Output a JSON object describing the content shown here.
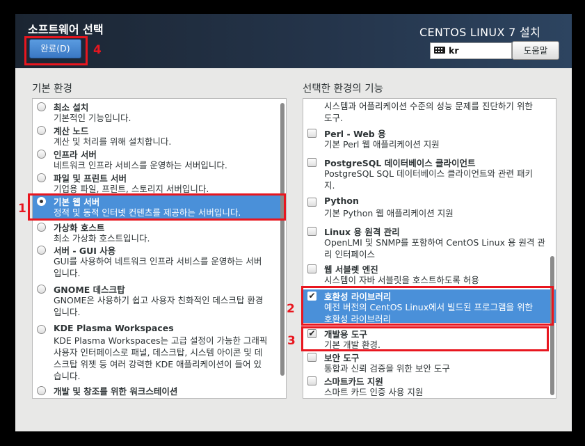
{
  "header": {
    "title": "소프트웨어 선택",
    "done_label": "완료(D)",
    "product": "CENTOS LINUX 7 설치",
    "keyboard_layout": "kr",
    "help_label": "도움말"
  },
  "environments": {
    "title": "기본 환경",
    "items": [
      {
        "name": "최소 설치",
        "desc": "기본적인 기능입니다."
      },
      {
        "name": "계산 노드",
        "desc": "계산 및 처리를 위해 설치합니다."
      },
      {
        "name": "인프라 서버",
        "desc": "네트워크 인프라 서비스를 운영하는 서버입니다."
      },
      {
        "name": "파일 및 프린트 서버",
        "desc": "기업용 파일, 프린트, 스토리지 서버입니다."
      },
      {
        "name": "기본 웹 서버",
        "desc": "정적 및 동적 인터넷 컨텐츠를 제공하는 서버입니다."
      },
      {
        "name": "가상화 호스트",
        "desc": "최소 가상화 호스트입니다."
      },
      {
        "name": "서버 - GUI 사용",
        "desc": "GUI를 사용하여 네트워크 인프라 서비스를 운영하는 서버\n입니다."
      },
      {
        "name": "GNOME 데스크탑",
        "desc": "GNOME은 사용하기 쉽고 사용자 친화적인 데스크탑 환경\n입니다."
      },
      {
        "name": "KDE Plasma Workspaces",
        "desc": "KDE Plasma Workspaces는 고급 설정이 가능한 그래픽\n사용자 인터페이스로 패널, 데스크탑, 시스템 아이콘 및 데\n스크탑 위젯 등 여러 강력한 KDE 애플리케이션이 들어 있\n습니다."
      },
      {
        "name": "개발 및 창조를 위한 워크스테이션",
        "desc": ""
      }
    ]
  },
  "addons": {
    "title": "선택한 환경의 기능",
    "items": [
      {
        "name": "",
        "desc": "시스템과 어플리케이션 수준의 성능 문제를 진단하기 위한\n도구."
      },
      {
        "name": "Perl - Web 용",
        "desc": "기본 Perl 웹 애플리케이션 지원"
      },
      {
        "name": "PostgreSQL 데이터베이스 클라이언트",
        "desc": "PostgreSQL SQL 데이터베이스 클라이언트와 관련 패키\n지."
      },
      {
        "name": "Python",
        "desc": "기본 Python 웹 애플리케이션 지원"
      },
      {
        "name": "Linux 용 원격 관리",
        "desc": "OpenLMI 및 SNMP를 포함하여 CentOS Linux 용 원격 관\n리 인터페이스"
      },
      {
        "name": "웹 서블렛 엔진",
        "desc": "시스템이 자바 서블릿을 호스트하도록 허용"
      },
      {
        "name": "호환성 라이브러리",
        "desc": "예전 버전의 CentOS Linux에서 빌드된 프로그램을 위한\n호환성 라이브러리",
        "checked": "✔"
      },
      {
        "name": "개발용 도구",
        "desc": "기본 개발 환경.",
        "checked": "✔"
      },
      {
        "name": "보안 도구",
        "desc": "통합과 신뢰 검증을 위한 보안 도구"
      },
      {
        "name": "스마트카드 지원",
        "desc": "스마트 카드 인증 사용 지원"
      }
    ]
  },
  "annotations": [
    "1",
    "2",
    "3",
    "4"
  ],
  "colors": {
    "selection": "#4a90d9",
    "annotation": "#e8161f"
  }
}
